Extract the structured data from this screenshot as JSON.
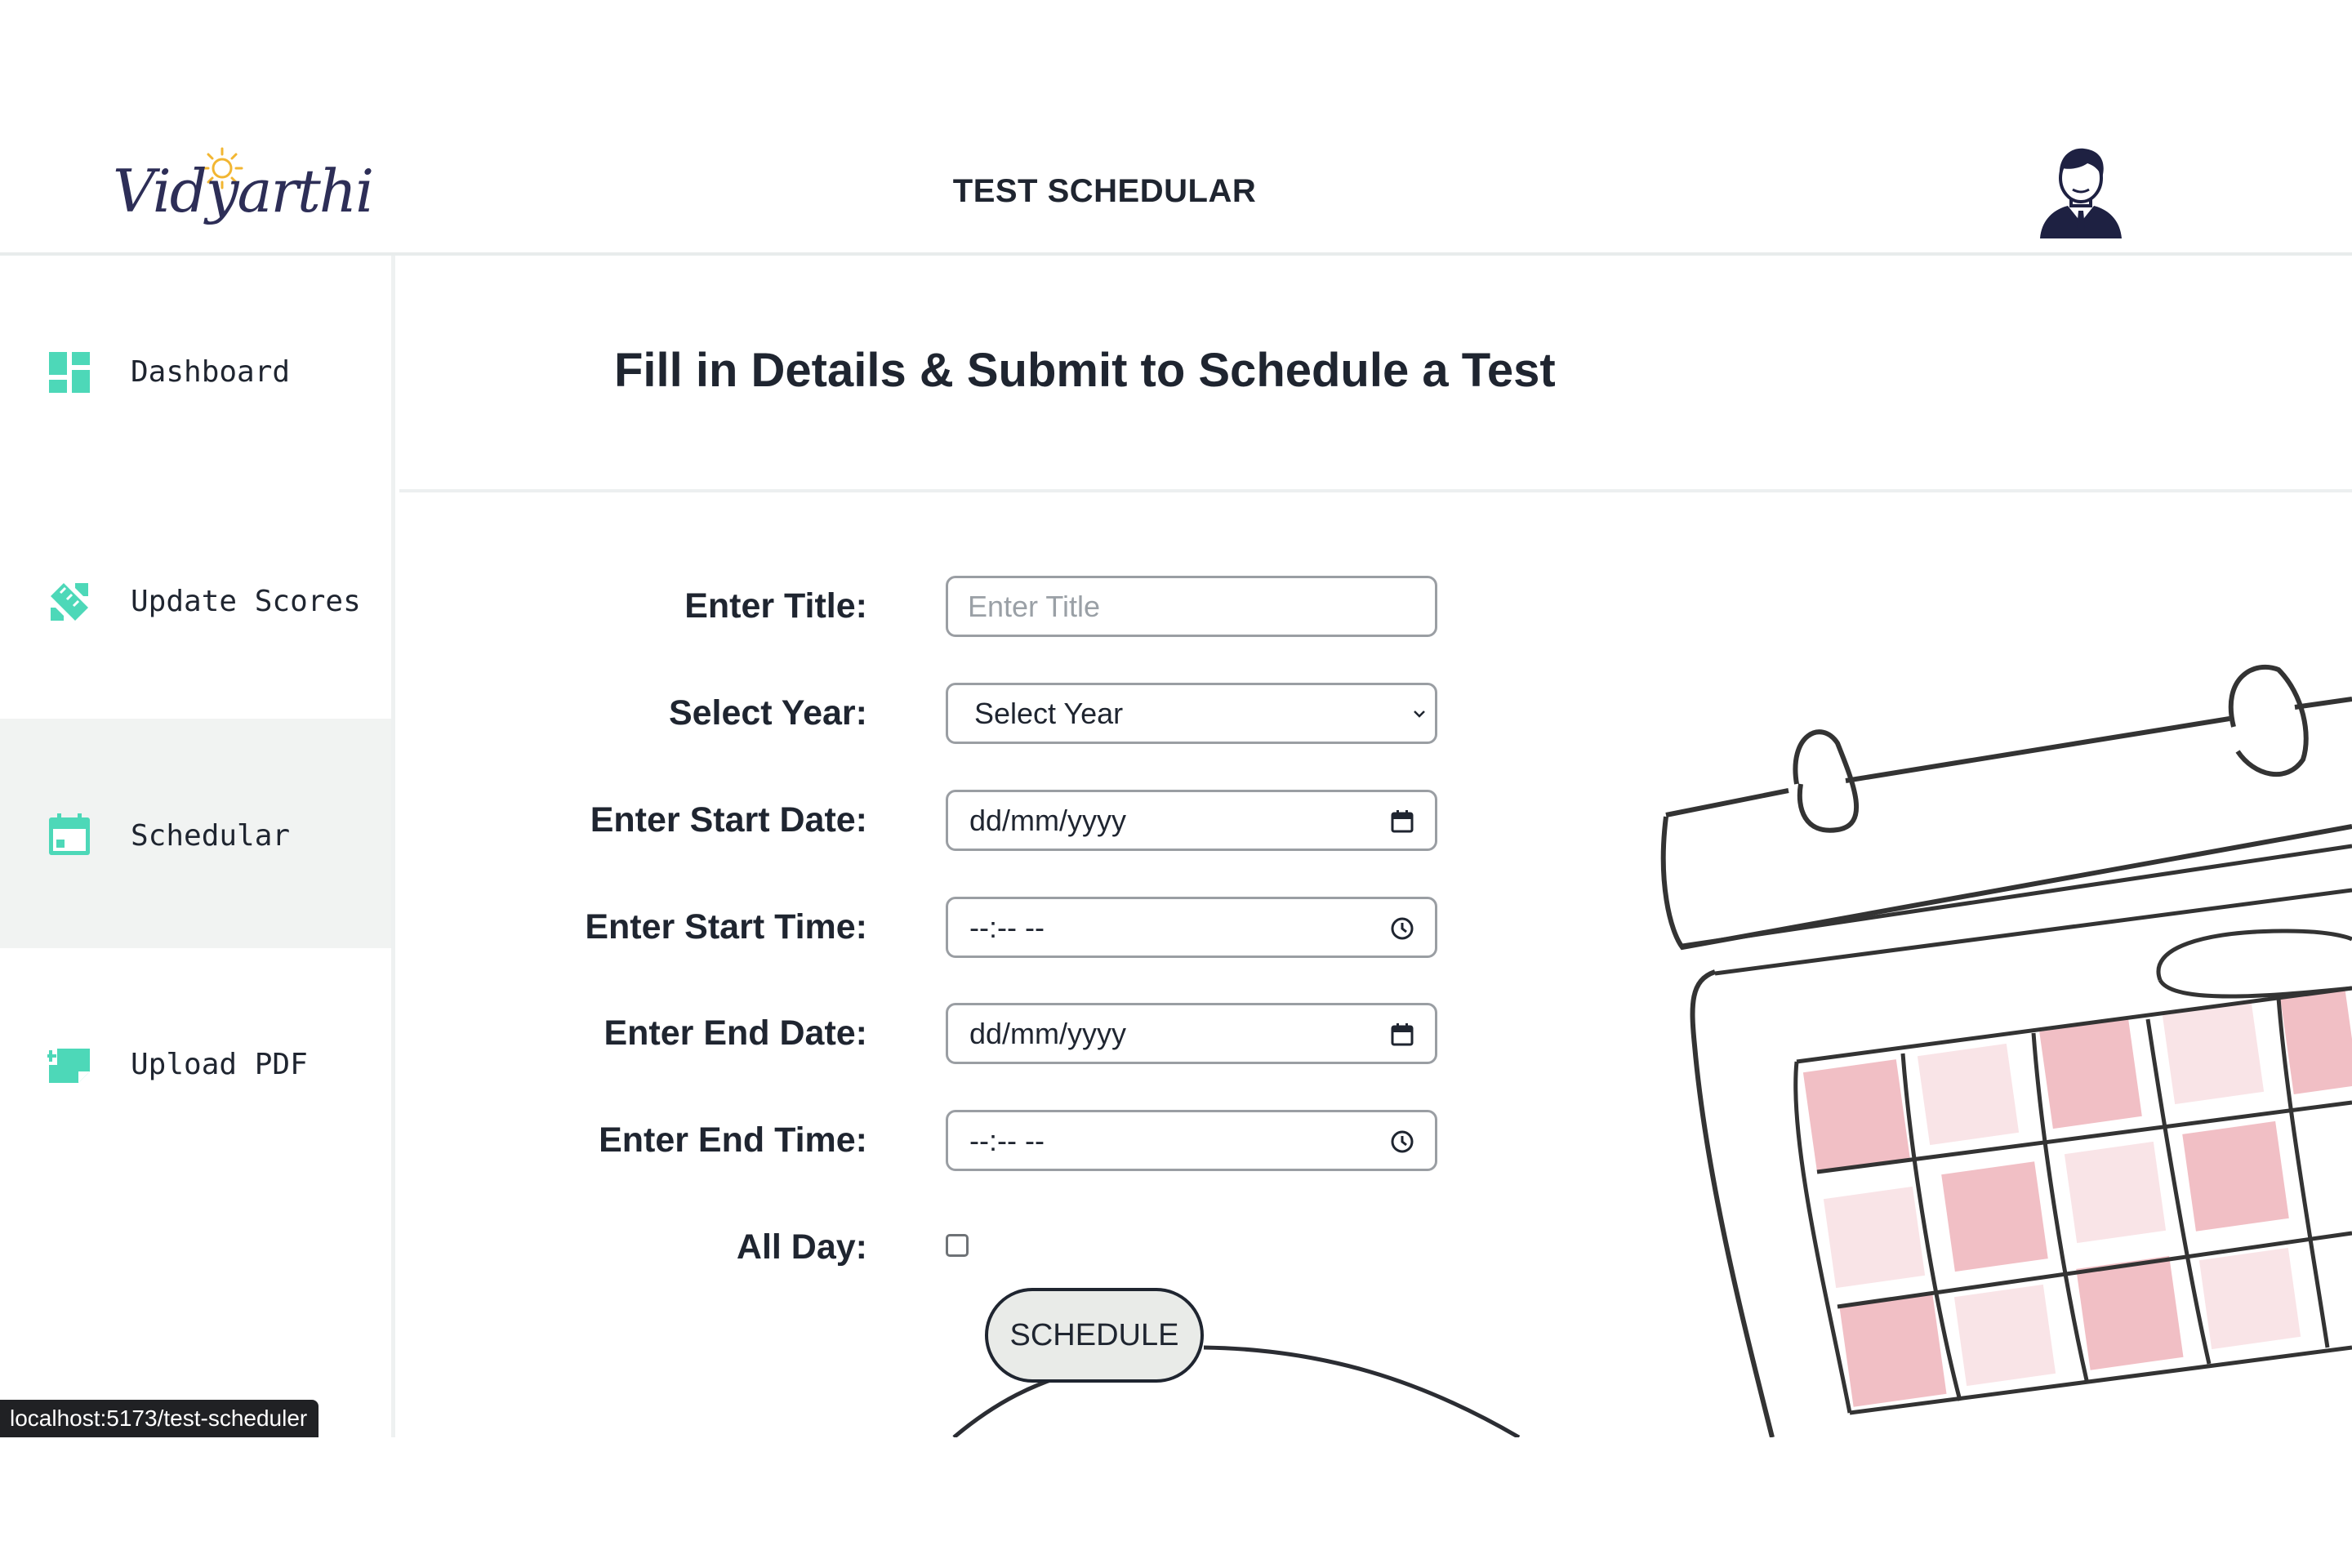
{
  "brand": {
    "logo_text": "Vidyarthi"
  },
  "header": {
    "title": "TEST SCHEDULAR"
  },
  "sidebar": {
    "items": [
      {
        "label": "Dashboard",
        "icon": "dashboard-icon",
        "active": false
      },
      {
        "label": "Update Scores",
        "icon": "ruler-pencil-icon",
        "active": false
      },
      {
        "label": "Schedular",
        "icon": "calendar-icon",
        "active": true
      },
      {
        "label": "Upload PDF",
        "icon": "add-note-icon",
        "active": false
      }
    ]
  },
  "main": {
    "title": "Fill in Details & Submit to Schedule a Test",
    "form": {
      "title_label": "Enter Title:",
      "title_placeholder": "Enter Title",
      "year_label": "Select Year:",
      "year_value": "Select Year",
      "start_date_label": "Enter Start Date:",
      "start_date_value": "dd/mm/yyyy",
      "start_time_label": "Enter Start Time:",
      "start_time_value": "--:-- --",
      "end_date_label": "Enter End Date:",
      "end_date_value": "dd/mm/yyyy",
      "end_time_label": "Enter End Time:",
      "end_time_value": "--:-- --",
      "all_day_label": "All Day:",
      "all_day_checked": false,
      "submit_label": "SCHEDULE"
    }
  },
  "status_bar": {
    "url": "localhost:5173/test-scheduler"
  },
  "colors": {
    "accent": "#4dd8b8",
    "text": "#1f2530",
    "active_bg": "#f1f3f2",
    "calendar_cells": "#f0b8bf"
  }
}
